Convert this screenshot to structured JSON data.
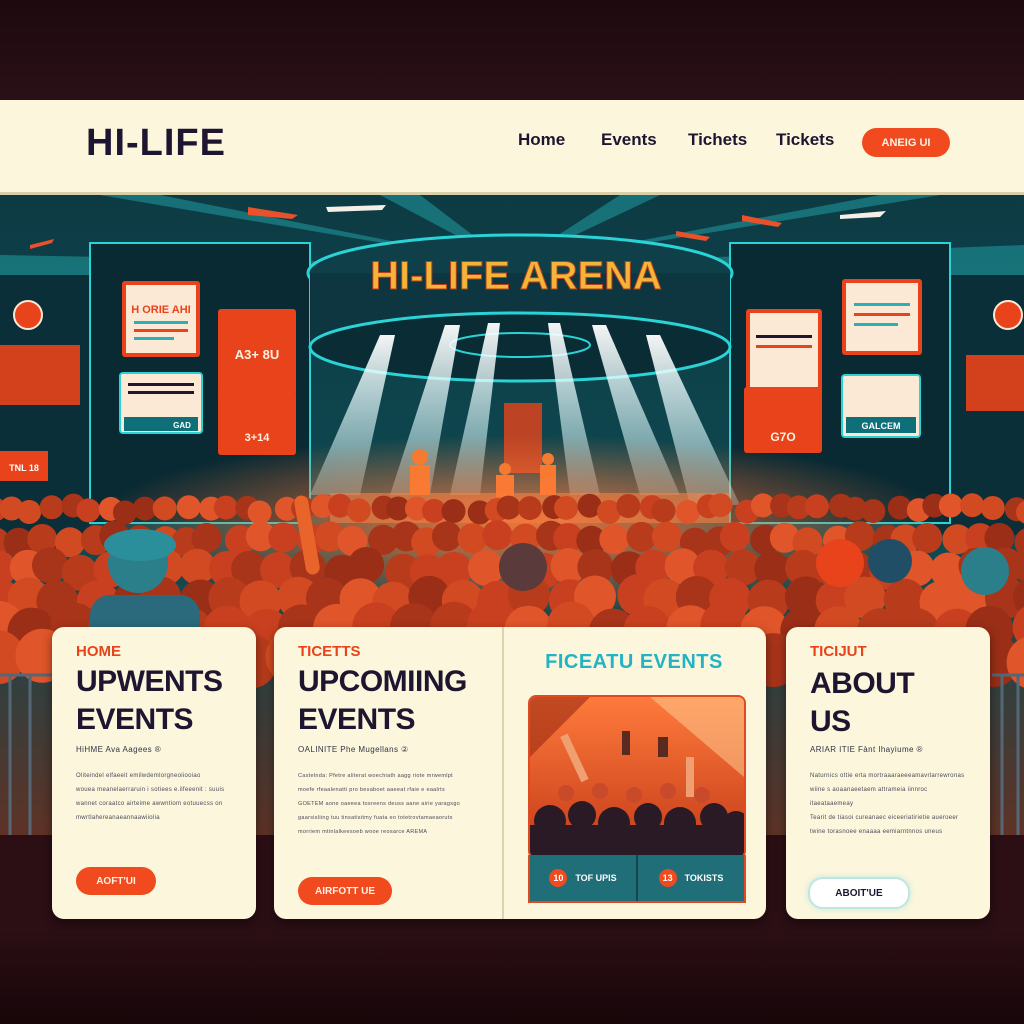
{
  "header": {
    "logo": "HI-LIFE",
    "nav": [
      "Home",
      "Events",
      "Tichets",
      "Tickets"
    ],
    "cta": "ANEIG UI"
  },
  "hero": {
    "arena_title": "HI-LIFE ARENA",
    "screens": {
      "left_top": "H ORIE AHI",
      "left_mid": "A3+ 8U",
      "left_low": "3+14",
      "left_small": "GAD",
      "left_edge": "TNL 18",
      "right_mid": "G7O",
      "right_low": "GALCEM"
    }
  },
  "cards": {
    "home": {
      "kicker": "HOME",
      "heading_1": "UPWENTS",
      "heading_2": "EVENTS",
      "sub": "HiHME Ava Aagees ®",
      "lines": [
        "Oliteindel elfaeeit emilwdemlorgneoiiooiao",
        "wouea meanelaerraruin i sotiees e.ilfeeenit : suuis",
        "wannet coraatco airteime awwntiom eotuuecss on",
        "mwrtlahereanaeannaawiiolia"
      ],
      "button": "AOFT'UI"
    },
    "tickets": {
      "kicker": "TICETTS",
      "heading_1": "UPCOMIING",
      "heading_2": "EVENTS",
      "sub": "OALINITE Phe Mugellans ②",
      "lines": [
        "Castelnda: Pfetre aliterat woechiath aagg riote mrwemlpt",
        "moefe rfeaalenatti pro besaboet aaeeat rfaie e eaalrts",
        "GOETEM aone oaeeea tosreens deuss aane airie yaragsgo",
        "gaarsisliing tuu tinsatisitmy fuata eo totetrovtamaeaoruts",
        "morriem mtinlalkeesoeb wooe reosarce AREMA"
      ],
      "button": "AIRFOTT UE"
    },
    "featured": {
      "title": "FICEATU EVENTS",
      "left_icon": "10",
      "left_label": "TOF UPIS",
      "right_icon": "13",
      "right_label": "TOKISTS"
    },
    "about": {
      "kicker": "TICIJUT",
      "heading_1": "ABOUT",
      "heading_2": "US",
      "sub": "ARIAR ITIE Fànt Ihayiume ®",
      "lines": [
        "Naturnics ottie erta mortraaaraeeeamavrlarrewronas",
        "wiine s aoaanaeetaem attrameia iinnroc itaeataaemeay",
        "Tearit de tiasoi cureanaec eiceeriatirietie  aueroeer",
        "twine torasnoee enaaaa eemiarntnnos uneus"
      ],
      "button": "ABOIT'UE"
    }
  },
  "colors": {
    "accent": "#f04a1e",
    "teal": "#23b3c4",
    "navy": "#1e1630",
    "cream": "#fbf6dc"
  }
}
